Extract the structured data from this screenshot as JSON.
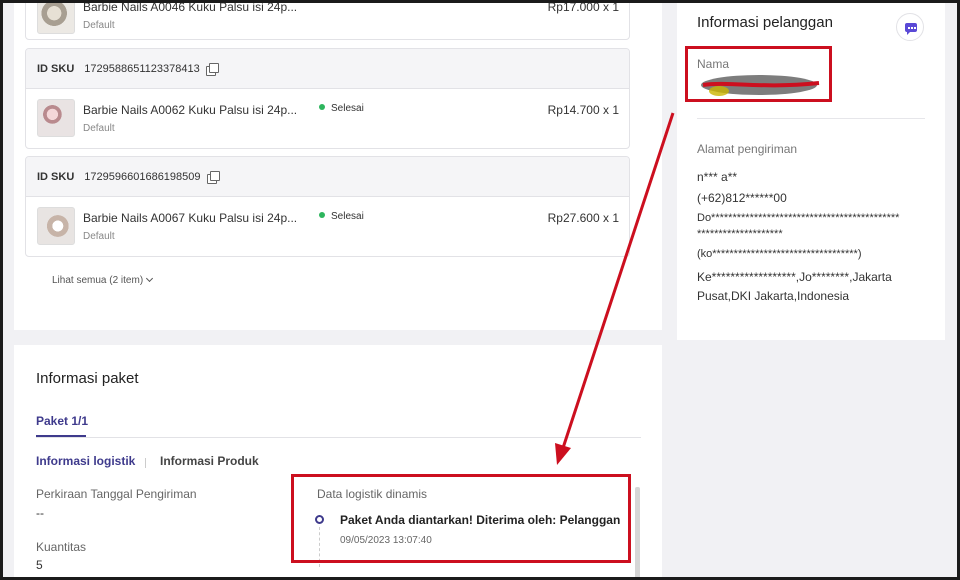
{
  "order_items": [
    {
      "sku_label": "ID SKU",
      "sku_id": "",
      "product_name": "Barbie Nails A0046 Kuku Palsu isi 24p...",
      "variant": "Default",
      "status": "",
      "price": "Rp17.000 x 1"
    },
    {
      "sku_label": "ID SKU",
      "sku_id": "1729588651123378413",
      "product_name": "Barbie Nails A0062 Kuku Palsu isi 24p...",
      "variant": "Default",
      "status": "Selesai",
      "price": "Rp14.700 x 1"
    },
    {
      "sku_label": "ID SKU",
      "sku_id": "1729596601686198509",
      "product_name": "Barbie Nails A0067 Kuku Palsu isi 24p...",
      "variant": "Default",
      "status": "Selesai",
      "price": "Rp27.600 x 1"
    }
  ],
  "see_all": "Lihat semua (2 item)",
  "package_info": {
    "title": "Informasi paket",
    "tab": "Paket 1/1",
    "subtabs": [
      "Informasi logistik",
      "Informasi Produk"
    ],
    "fields": [
      {
        "label": "Perkiraan Tanggal Pengiriman",
        "value": "--"
      },
      {
        "label": "Kuantitas",
        "value": "5"
      }
    ],
    "logistics": {
      "label": "Data logistik dinamis",
      "event": "Paket Anda diantarkan! Diterima oleh: Pelanggan",
      "time": "09/05/2023 13:07:40"
    }
  },
  "customer_info": {
    "title": "Informasi pelanggan",
    "name_label": "Nama",
    "address_label": "Alamat pengiriman",
    "address_lines": [
      "n*** a**",
      "(+62)812******00",
      "Do********************************************",
      "********************",
      "(ko**********************************)",
      "Ke******************,Jo********,Jakarta",
      "Pusat,DKI Jakarta,Indonesia"
    ]
  },
  "colors": {
    "accent": "#3e3a8c",
    "status_green": "#2db55d",
    "annotation_red": "#cc0f1f",
    "chat_icon": "#5a49d6"
  }
}
